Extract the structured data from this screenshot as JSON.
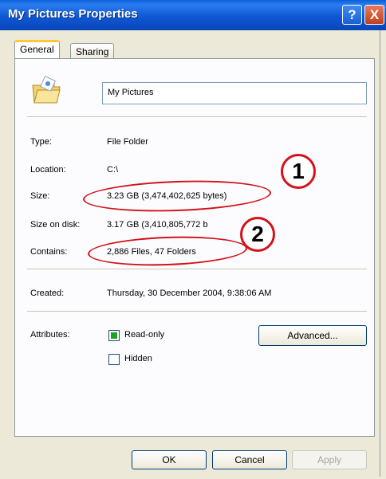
{
  "window": {
    "title": "My Pictures Properties",
    "help_glyph": "?",
    "close_glyph": "X"
  },
  "tabs": [
    {
      "label": "General",
      "active": true
    },
    {
      "label": "Sharing",
      "active": false
    }
  ],
  "general": {
    "folder_name": "My Pictures",
    "fields": [
      {
        "label": "Type:",
        "value": "File Folder"
      },
      {
        "label": "Location:",
        "value": "C:\\"
      },
      {
        "label": "Size:",
        "value": "3.23 GB (3,474,402,625 bytes)"
      },
      {
        "label": "Size on disk:",
        "value": "3.17 GB (3,410,805,772 b"
      },
      {
        "label": "Contains:",
        "value": "2,886 Files, 47 Folders"
      },
      {
        "label": "Created:",
        "value": "Thursday, 30 December 2004, 9:38:06 AM"
      }
    ],
    "attributes": {
      "label": "Attributes:",
      "read_only": {
        "label": "Read-only",
        "state": "mixed"
      },
      "hidden": {
        "label": "Hidden",
        "state": "unchecked"
      },
      "advanced_label": "Advanced..."
    }
  },
  "buttons": {
    "ok": "OK",
    "cancel": "Cancel",
    "apply": "Apply"
  },
  "annotations": {
    "marker_1": "1",
    "marker_2": "2",
    "color": "#d3121b"
  }
}
